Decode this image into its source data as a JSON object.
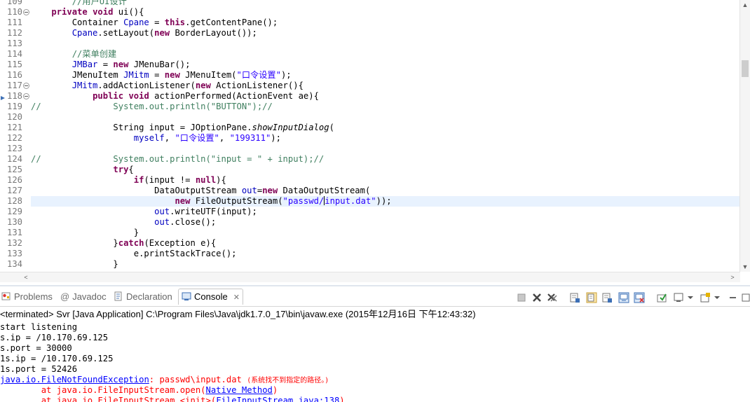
{
  "editor": {
    "lines": [
      {
        "n": "109",
        "fold": false,
        "parts": [
          {
            "t": "        "
          },
          {
            "t": "//用户UI设计",
            "c": "cm"
          }
        ]
      },
      {
        "n": "110",
        "fold": true,
        "parts": [
          {
            "t": "    "
          },
          {
            "t": "private",
            "c": "kw"
          },
          {
            "t": " "
          },
          {
            "t": "void",
            "c": "kw"
          },
          {
            "t": " ui(){"
          }
        ]
      },
      {
        "n": "111",
        "fold": false,
        "parts": [
          {
            "t": "        Container "
          },
          {
            "t": "Cpane",
            "c": "fld"
          },
          {
            "t": " = "
          },
          {
            "t": "this",
            "c": "kw"
          },
          {
            "t": ".getContentPane();"
          }
        ]
      },
      {
        "n": "112",
        "fold": false,
        "parts": [
          {
            "t": "        "
          },
          {
            "t": "Cpane",
            "c": "fld"
          },
          {
            "t": ".setLayout("
          },
          {
            "t": "new",
            "c": "kw"
          },
          {
            "t": " BorderLayout());"
          }
        ]
      },
      {
        "n": "113",
        "fold": false,
        "parts": [
          {
            "t": ""
          }
        ]
      },
      {
        "n": "114",
        "fold": false,
        "parts": [
          {
            "t": "        "
          },
          {
            "t": "//菜单创建",
            "c": "cm"
          }
        ]
      },
      {
        "n": "115",
        "fold": false,
        "parts": [
          {
            "t": "        "
          },
          {
            "t": "JMBar",
            "c": "fld"
          },
          {
            "t": " = "
          },
          {
            "t": "new",
            "c": "kw"
          },
          {
            "t": " JMenuBar();"
          }
        ]
      },
      {
        "n": "116",
        "fold": false,
        "parts": [
          {
            "t": "        JMenuItem "
          },
          {
            "t": "JMitm",
            "c": "fld"
          },
          {
            "t": " = "
          },
          {
            "t": "new",
            "c": "kw"
          },
          {
            "t": " JMenuItem("
          },
          {
            "t": "\"口令设置\"",
            "c": "st"
          },
          {
            "t": ");"
          }
        ]
      },
      {
        "n": "117",
        "fold": true,
        "parts": [
          {
            "t": "        "
          },
          {
            "t": "JMitm",
            "c": "fld"
          },
          {
            "t": ".addActionListener("
          },
          {
            "t": "new",
            "c": "kw"
          },
          {
            "t": " ActionListener(){"
          }
        ]
      },
      {
        "n": "118",
        "fold": true,
        "err": true,
        "parts": [
          {
            "t": "            "
          },
          {
            "t": "public",
            "c": "kw"
          },
          {
            "t": " "
          },
          {
            "t": "void",
            "c": "kw"
          },
          {
            "t": " actionPerformed(ActionEvent ae){"
          }
        ]
      },
      {
        "n": "119",
        "fold": false,
        "parts": [
          {
            "t": "//              System.out.println(\"BUTTON\");//",
            "c": "cm"
          }
        ]
      },
      {
        "n": "120",
        "fold": false,
        "parts": [
          {
            "t": ""
          }
        ]
      },
      {
        "n": "121",
        "fold": false,
        "parts": [
          {
            "t": "                String input = JOptionPane."
          },
          {
            "t": "showInputDialog",
            "c": "it"
          },
          {
            "t": "("
          }
        ]
      },
      {
        "n": "122",
        "fold": false,
        "parts": [
          {
            "t": "                    "
          },
          {
            "t": "myself",
            "c": "fld"
          },
          {
            "t": ", "
          },
          {
            "t": "\"口令设置\"",
            "c": "st"
          },
          {
            "t": ", "
          },
          {
            "t": "\"199311\"",
            "c": "st"
          },
          {
            "t": ");"
          }
        ]
      },
      {
        "n": "123",
        "fold": false,
        "parts": [
          {
            "t": ""
          }
        ]
      },
      {
        "n": "124",
        "fold": false,
        "parts": [
          {
            "t": "//              System.out.println(\"input = \" + input);//",
            "c": "cm"
          }
        ]
      },
      {
        "n": "125",
        "fold": false,
        "parts": [
          {
            "t": "                "
          },
          {
            "t": "try",
            "c": "kw"
          },
          {
            "t": "{"
          }
        ]
      },
      {
        "n": "126",
        "fold": false,
        "parts": [
          {
            "t": "                    "
          },
          {
            "t": "if",
            "c": "kw"
          },
          {
            "t": "(input != "
          },
          {
            "t": "null",
            "c": "kw"
          },
          {
            "t": "){"
          }
        ]
      },
      {
        "n": "127",
        "fold": false,
        "parts": [
          {
            "t": "                        DataOutputStream "
          },
          {
            "t": "out",
            "c": "fld"
          },
          {
            "t": "="
          },
          {
            "t": "new",
            "c": "kw"
          },
          {
            "t": " DataOutputStream("
          }
        ]
      },
      {
        "n": "128",
        "fold": false,
        "current": true,
        "parts": [
          {
            "t": "                            "
          },
          {
            "t": "new",
            "c": "kw"
          },
          {
            "t": " FileOutputStream("
          },
          {
            "t": "\"passwd/",
            "c": "st"
          },
          {
            "caret": true
          },
          {
            "t": "input.dat\"",
            "c": "st"
          },
          {
            "t": "));"
          }
        ]
      },
      {
        "n": "129",
        "fold": false,
        "parts": [
          {
            "t": "                        "
          },
          {
            "t": "out",
            "c": "fld"
          },
          {
            "t": ".writeUTF(input);"
          }
        ]
      },
      {
        "n": "130",
        "fold": false,
        "parts": [
          {
            "t": "                        "
          },
          {
            "t": "out",
            "c": "fld"
          },
          {
            "t": ".close();"
          }
        ]
      },
      {
        "n": "131",
        "fold": false,
        "parts": [
          {
            "t": "                    }"
          }
        ]
      },
      {
        "n": "132",
        "fold": false,
        "parts": [
          {
            "t": "                }"
          },
          {
            "t": "catch",
            "c": "kw"
          },
          {
            "t": "(Exception e){"
          }
        ]
      },
      {
        "n": "133",
        "fold": false,
        "parts": [
          {
            "t": "                    e.printStackTrace();"
          }
        ]
      },
      {
        "n": "134",
        "fold": false,
        "parts": [
          {
            "t": "                }"
          }
        ]
      }
    ]
  },
  "panel": {
    "tabs": [
      {
        "name": "tab-problems",
        "label": "Problems",
        "icon": "problems-icon",
        "active": false
      },
      {
        "name": "tab-javadoc",
        "label": "Javadoc",
        "icon": "at-icon",
        "active": false
      },
      {
        "name": "tab-declaration",
        "label": "Declaration",
        "icon": "declaration-icon",
        "active": false
      },
      {
        "name": "tab-console",
        "label": "Console",
        "icon": "console-icon",
        "active": true,
        "close": "✕"
      }
    ],
    "terminated": "<terminated> Svr [Java Application] C:\\Program Files\\Java\\jdk1.7.0_17\\bin\\javaw.exe (2015年12月16日 下午12:43:32)",
    "console_lines": [
      {
        "parts": [
          {
            "t": "start listening"
          }
        ]
      },
      {
        "parts": [
          {
            "t": "s.ip = /10.170.69.125"
          }
        ]
      },
      {
        "parts": [
          {
            "t": "s.port = 30000"
          }
        ]
      },
      {
        "parts": [
          {
            "t": "1s.ip = /10.170.69.125"
          }
        ]
      },
      {
        "parts": [
          {
            "t": "1s.port = 52426"
          }
        ]
      },
      {
        "err": true,
        "parts": [
          {
            "t": "java.io.FileNotFoundException",
            "link": true
          },
          {
            "t": ": passwd\\input.dat "
          },
          {
            "t": "(系统找不到指定的路径。)",
            "small": true
          }
        ]
      },
      {
        "err": true,
        "parts": [
          {
            "t": "        at java.io.FileInputStream.open("
          },
          {
            "t": "Native Method",
            "link": true
          },
          {
            "t": ")"
          }
        ]
      },
      {
        "err": true,
        "parts": [
          {
            "t": "        at java.io.FileInputStream.<init>("
          },
          {
            "t": "FileInputStream.java:138",
            "link": true
          },
          {
            "t": ")"
          }
        ]
      }
    ]
  }
}
